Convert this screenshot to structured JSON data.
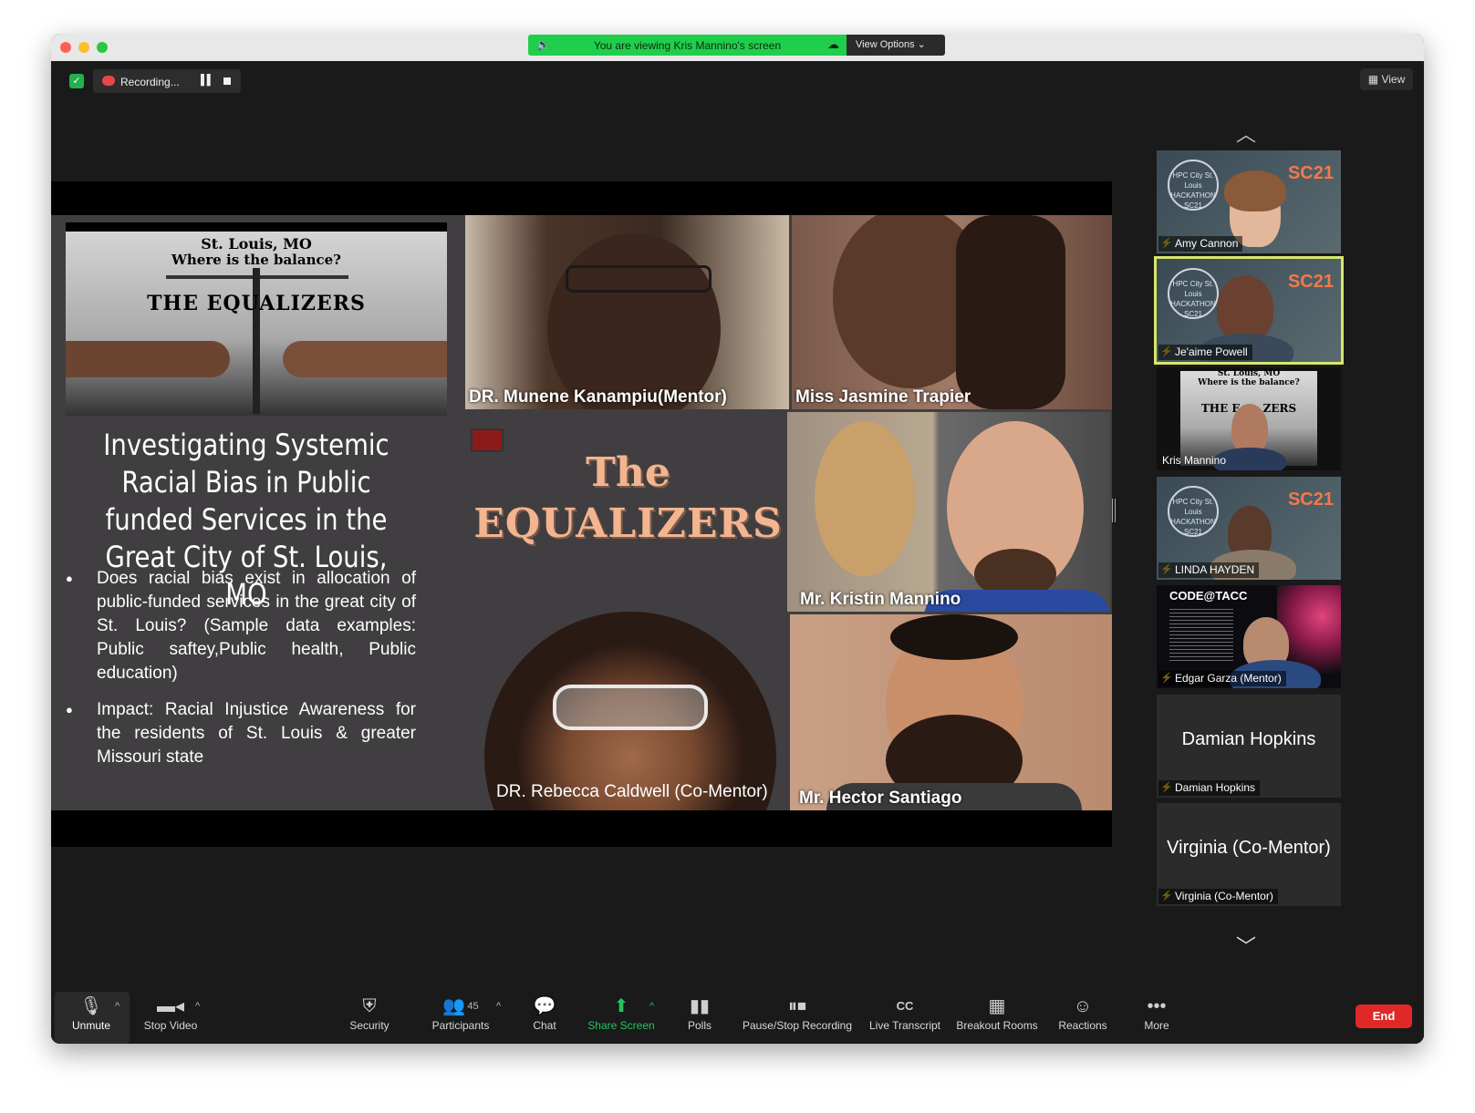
{
  "window": {
    "banner_text": "You are viewing Kris Mannino's screen",
    "view_options_label": "View Options ⌄",
    "recording_label": "Recording...",
    "view_label": "View"
  },
  "slide": {
    "image_line1": "St. Louis, MO",
    "image_line2": "Where is the balance?",
    "image_line3": "THE EQUALIZERS",
    "title": "Investigating Systemic Racial Bias in Public funded Services in the Great City of St. Louis, MO",
    "bullets": [
      "Does racial bias exist in allocation of public-funded services in the great city of St. Louis? (Sample data examples: Public saftey,Public health, Public education)",
      "Impact: Racial Injustice Awareness for the residents of St. Louis & greater Missouri state"
    ],
    "center_title_1": "The",
    "center_title_2": "EQUALIZERS",
    "tiles": [
      "DR. Munene Kanampiu(Mentor)",
      "Miss Jasmine Trapier",
      "Mr. Kristin Mannino",
      "DR. Rebecca Caldwell (Co-Mentor)",
      "Mr. Hector Santiago"
    ]
  },
  "participants": [
    {
      "name": "Amy Cannon",
      "muted": true
    },
    {
      "name": "Je'aime Powell",
      "muted": true,
      "active": true
    },
    {
      "name": "Kris Mannino",
      "muted": false
    },
    {
      "name": "LINDA HAYDEN",
      "muted": true
    },
    {
      "name": "Edgar Garza (Mentor)",
      "muted": true
    },
    {
      "name": "Damian Hopkins",
      "muted": true,
      "display": "Damian Hopkins"
    },
    {
      "name": "Virginia (Co-Mentor)",
      "muted": true,
      "display": "Virginia (Co-Mentor)"
    }
  ],
  "thumb_text": {
    "sc21": "SC21",
    "hpc": "HPC City St. Louis HACKATHON SC21",
    "kris_line1": "St. Louis, MO",
    "kris_line2": "Where is the balance?",
    "kris_line3": "THE E      ZERS",
    "codetacc": "CODE@TACC"
  },
  "toolbar": {
    "unmute": "Unmute",
    "stop_video": "Stop Video",
    "security": "Security",
    "participants": "Participants",
    "participants_count": "45",
    "chat": "Chat",
    "share_screen": "Share Screen",
    "polls": "Polls",
    "pause_stop_recording": "Pause/Stop Recording",
    "live_transcript": "Live Transcript",
    "breakout_rooms": "Breakout Rooms",
    "reactions": "Reactions",
    "more": "More",
    "end": "End"
  },
  "colors": {
    "banner_green": "#1fcf4c",
    "active_speaker": "#d6e76a",
    "end_red": "#e02828",
    "title_peach": "#f3b490"
  }
}
